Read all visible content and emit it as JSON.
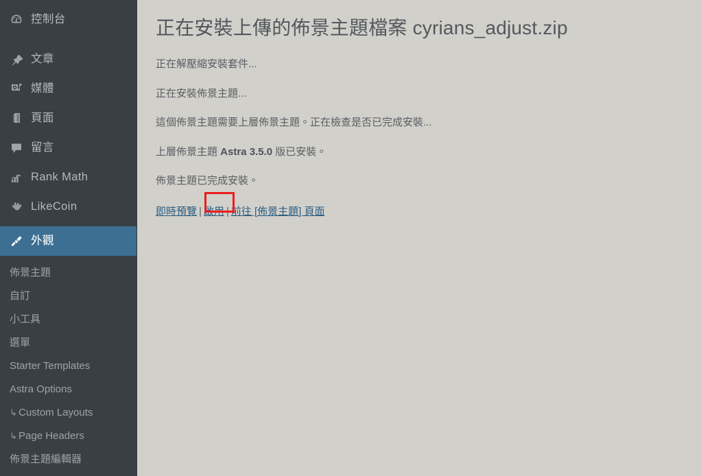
{
  "sidebar": {
    "items": [
      {
        "id": "dashboard",
        "label": "控制台",
        "icon": "dashboard-icon"
      },
      {
        "id": "posts",
        "label": "文章",
        "icon": "pin-icon"
      },
      {
        "id": "media",
        "label": "媒體",
        "icon": "media-icon"
      },
      {
        "id": "pages",
        "label": "頁面",
        "icon": "page-icon"
      },
      {
        "id": "comments",
        "label": "留言",
        "icon": "comment-icon"
      },
      {
        "id": "rank-math",
        "label": "Rank Math",
        "icon": "chart-icon"
      },
      {
        "id": "likecoin",
        "label": "LikeCoin",
        "icon": "hand-icon"
      }
    ],
    "active": {
      "id": "appearance",
      "label": "外觀",
      "icon": "brush-icon"
    },
    "submenu": [
      {
        "id": "themes",
        "label": "佈景主題",
        "sub": false
      },
      {
        "id": "customize",
        "label": "自訂",
        "sub": false
      },
      {
        "id": "widgets",
        "label": "小工具",
        "sub": false
      },
      {
        "id": "menus",
        "label": "選單",
        "sub": false
      },
      {
        "id": "starter-templates",
        "label": "Starter Templates",
        "sub": false
      },
      {
        "id": "astra-options",
        "label": "Astra Options",
        "sub": false
      },
      {
        "id": "custom-layouts",
        "label": "Custom Layouts",
        "sub": true
      },
      {
        "id": "page-headers",
        "label": "Page Headers",
        "sub": true
      },
      {
        "id": "theme-editor",
        "label": "佈景主題編輯器",
        "sub": false
      }
    ],
    "sub_arrow_glyph": "↳"
  },
  "main": {
    "title": "正在安裝上傳的佈景主題檔案 cyrians_adjust.zip",
    "status_lines": [
      {
        "text": "正在解壓縮安裝套件..."
      },
      {
        "text": "正在安裝佈景主題..."
      },
      {
        "text": "這個佈景主題需要上層佈景主題。正在檢查是否已完成安裝..."
      }
    ],
    "parent_theme_line": {
      "prefix": "上層佈景主題 ",
      "bold": "Astra 3.5.0",
      "suffix": " 版已安裝。"
    },
    "done_line": "佈景主題已完成安裝。",
    "links": {
      "preview": "即時預覽",
      "activate": "啟用",
      "go_to_themes": "前往 [佈景主題] 頁面",
      "separator": "|"
    }
  },
  "annotation": {
    "highlight_target": "啟用",
    "color": "#ed1c1c"
  },
  "colors": {
    "sidebar_bg": "#3a3f44",
    "active_bg": "#3c6f92",
    "content_bg": "#d2d0cb",
    "link": "#2b5e80",
    "text": "#5a5e62"
  }
}
